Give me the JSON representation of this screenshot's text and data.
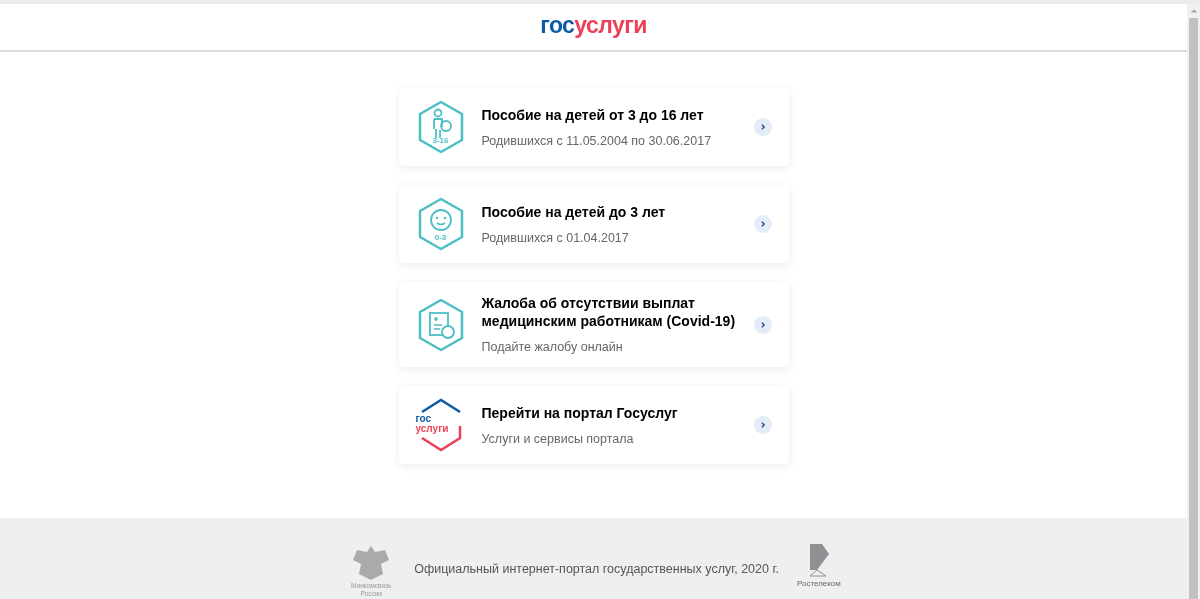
{
  "header": {
    "logo": {
      "part_1": "гос",
      "part_2": "услуги"
    }
  },
  "cards": [
    {
      "kind": "kids",
      "badge": "3-16",
      "title": "Пособие на детей от 3 до 16 лет",
      "subtitle": "Родившихся с 11.05.2004 по 30.06.2017"
    },
    {
      "kind": "baby",
      "badge": "0-3",
      "title": "Пособие на детей до 3 лет",
      "subtitle": "Родившихся с 01.04.2017"
    },
    {
      "kind": "complaint",
      "title": "Жалоба об отсутствии выплат медицинским работникам (Covid-19)",
      "subtitle": "Подайте жалобу онлайн"
    },
    {
      "kind": "portal",
      "badge_1": "гос",
      "badge_2": "услуги",
      "title": "Перейти на портал Госуслуг",
      "subtitle": "Услуги и сервисы портала"
    }
  ],
  "footer": {
    "ministry": "Минкомсвязь России",
    "text": "Официальный интернет-портал государственных услуг, 2020 г.",
    "operator": "Ростелеком"
  }
}
